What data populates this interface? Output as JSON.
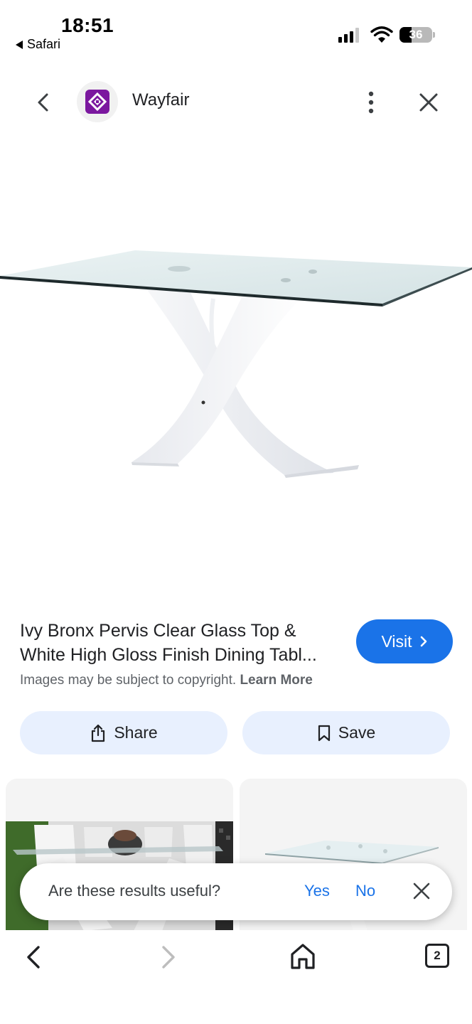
{
  "status_bar": {
    "time": "18:51",
    "back_app": "Safari",
    "battery_level": "36",
    "battery_fraction": 0.36
  },
  "header": {
    "site_name": "Wayfair",
    "icons": [
      "back-arrow-icon",
      "wayfair-logo-icon",
      "more-vert-icon",
      "close-icon"
    ],
    "brand_color": "#7b189f"
  },
  "result": {
    "title_line1": "Ivy Bronx Pervis Clear Glass Top &",
    "title_line2": "White High Gloss Finish Dining Tabl...",
    "copyright_text": "Images may be subject to copyright.",
    "learn_more": "Learn More",
    "visit_label": "Visit",
    "accent_color": "#1a73e8"
  },
  "actions": {
    "share_label": "Share",
    "save_label": "Save"
  },
  "feedback": {
    "question": "Are these results useful?",
    "yes": "Yes",
    "no": "No"
  },
  "bottom_nav": {
    "tabs_count": "2",
    "icons": [
      "back-icon",
      "forward-icon",
      "home-icon",
      "tabs-icon"
    ]
  }
}
